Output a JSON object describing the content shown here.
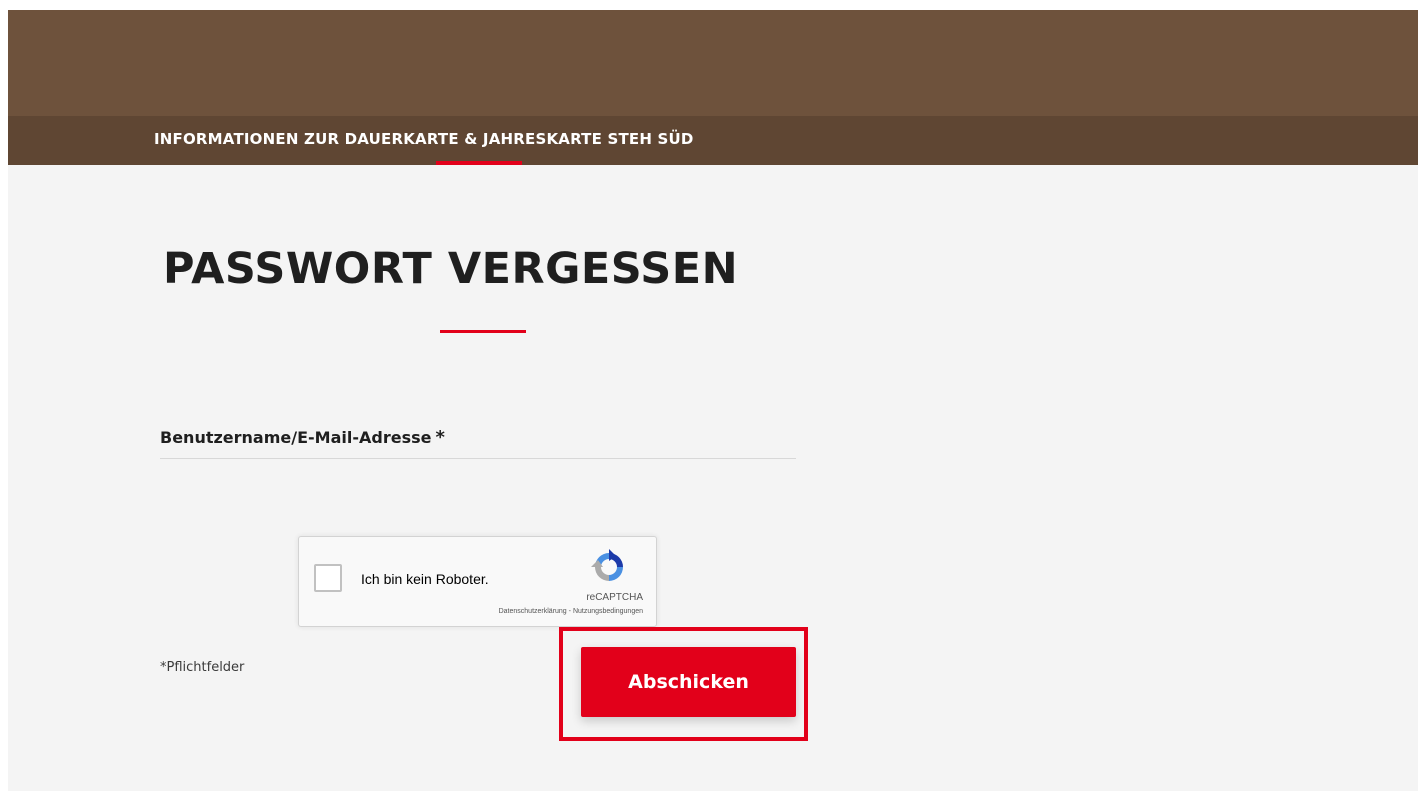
{
  "header": {
    "nav_item": "INFORMATIONEN ZUR DAUERKARTE & JAHRESKARTE STEH SÜD"
  },
  "main": {
    "title": "PASSWORT VERGESSEN",
    "username_field": {
      "label": "Benutzername/E-Mail-Adresse",
      "required_mark": "*",
      "value": ""
    },
    "captcha": {
      "label": "Ich bin kein Roboter.",
      "brand": "reCAPTCHA",
      "privacy_link": "Datenschutzerklärung",
      "separator": " - ",
      "terms_link": "Nutzungsbedingungen",
      "checked": false,
      "icon": "recaptcha-logo"
    },
    "required_note": "*Pflichtfelder",
    "submit_label": "Abschicken"
  },
  "colors": {
    "header_brown": "#6e523c",
    "subnav_brown": "#5f4633",
    "accent_red": "#e2001a",
    "page_background": "#f4f4f4"
  }
}
